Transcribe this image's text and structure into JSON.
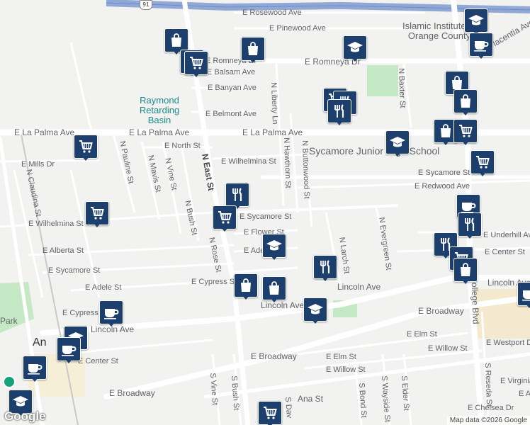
{
  "map": {
    "route_shield": "91",
    "streets": [
      "E Rosewood Ave",
      "E Pinewood Ave",
      "E Romneya Dr",
      "E Romneya Dr",
      "E Balsam Ave",
      "E Banyan Ave",
      "E Belmont Ave",
      "E La Palma Ave",
      "E La Palma Ave",
      "E La Palma Ave",
      "E North St",
      "E Wilhelmina St",
      "E Mills Dr",
      "N Claudina St",
      "N Pauline St",
      "N Mavis St",
      "N Vine St",
      "N Bush St",
      "N East St",
      "N Rose St",
      "E Sycamore St",
      "E Flower St",
      "E Adele St",
      "E Cypress St",
      "E Redwood Ave",
      "E Sycamore St",
      "N Liberty Ln",
      "N Hawthorn St",
      "N Buttonwood St",
      "N Baxter St",
      "N Evergreen St",
      "N Larch St",
      "E Wilhelmina St",
      "E Alberta St",
      "E Sycamore St",
      "E Adele St",
      "E Cypress St",
      "Lincoln Ave",
      "Lincoln Ave",
      "Lincoln Ave",
      "E Broadway",
      "E Broadway",
      "E Broadway",
      "E Elm St",
      "E Elm St",
      "E Willow St",
      "E Willow St",
      "E Center St",
      "E Center St",
      "E Underhill Ave",
      "E Westport Dr",
      "E Virginia",
      "E Chelsea Dr",
      "S Vine St",
      "S Bush St",
      "S Bond St",
      "S Wayside St",
      "S Elder St",
      "S Reseda St",
      "N College Blvd",
      "Placentia Ave",
      "N Vine St",
      "E Alo",
      "S Dav",
      "Ana St",
      "An",
      "Park",
      "N Rose St",
      "N Vine St",
      "N Mavis St"
    ],
    "places": {
      "basin": "Raymond Retarding Basin",
      "school": "Sycamore Junior High School",
      "islamic": "Islamic Institute of Orange County"
    },
    "attribution": "Map data ©2026 Google",
    "logo": "Google"
  },
  "colors": {
    "pin": "#1c3f6e",
    "highway": "#8fa8d6",
    "park": "#c5e8c5",
    "teal_label": "#1a8a8a"
  },
  "pins": [
    {
      "icon": "bag"
    },
    {
      "icon": "bag"
    },
    {
      "icon": "cart"
    },
    {
      "icon": "cart"
    },
    {
      "icon": "grad"
    },
    {
      "icon": "grad"
    },
    {
      "icon": "cup"
    },
    {
      "icon": "bag"
    },
    {
      "icon": "bag"
    },
    {
      "icon": "cart"
    },
    {
      "icon": "fork"
    },
    {
      "icon": "fork"
    },
    {
      "icon": "grad"
    },
    {
      "icon": "bag"
    },
    {
      "icon": "cart"
    },
    {
      "icon": "cart"
    },
    {
      "icon": "cart"
    },
    {
      "icon": "fork"
    },
    {
      "icon": "cart"
    },
    {
      "icon": "cart"
    },
    {
      "icon": "grad"
    },
    {
      "icon": "cup"
    },
    {
      "icon": "fork"
    },
    {
      "icon": "fork"
    },
    {
      "icon": "cart"
    },
    {
      "icon": "bag"
    },
    {
      "icon": "fork"
    },
    {
      "icon": "bag"
    },
    {
      "icon": "bag"
    },
    {
      "icon": "grad"
    },
    {
      "icon": "cup"
    },
    {
      "icon": "grad"
    },
    {
      "icon": "cup"
    },
    {
      "icon": "cup"
    },
    {
      "icon": "cart"
    },
    {
      "icon": "grad"
    },
    {
      "icon": "cup"
    }
  ]
}
